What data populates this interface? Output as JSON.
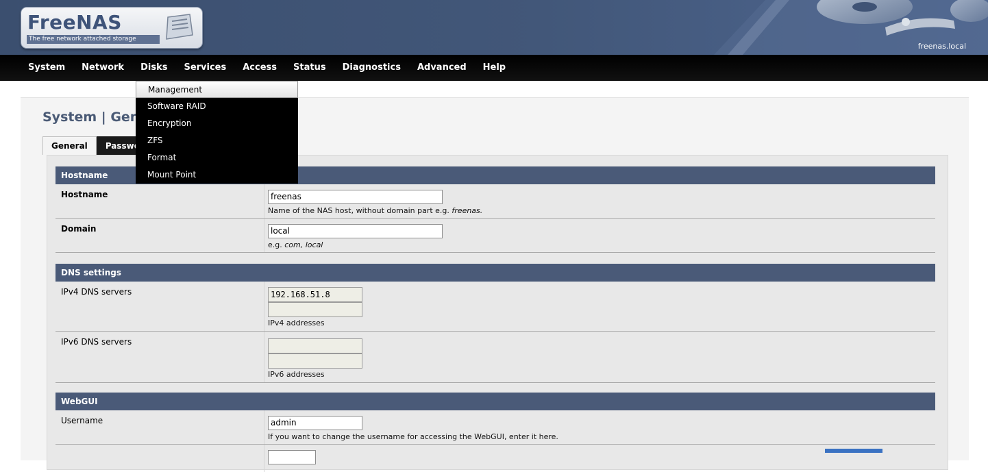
{
  "header": {
    "app_name": "FreeNAS",
    "tagline": "The free network attached storage",
    "hostname_display": "freenas.local"
  },
  "nav": {
    "items": [
      "System",
      "Network",
      "Disks",
      "Services",
      "Access",
      "Status",
      "Diagnostics",
      "Advanced",
      "Help"
    ]
  },
  "disks_menu": {
    "items": [
      "Management",
      "Software RAID",
      "Encryption",
      "ZFS",
      "Format",
      "Mount Point"
    ],
    "highlighted": "Management"
  },
  "page": {
    "title": "System | Gene",
    "tabs": [
      "General",
      "Passwo"
    ]
  },
  "sections": {
    "hostname": {
      "heading": "Hostname",
      "hostname_label": "Hostname",
      "hostname_value": "freenas",
      "hostname_hint_prefix": "Name of the NAS host, without domain part e.g. ",
      "hostname_hint_example": "freenas.",
      "domain_label": "Domain",
      "domain_value": "local",
      "domain_hint_prefix": "e.g. ",
      "domain_hint_example": "com, local"
    },
    "dns": {
      "heading": "DNS settings",
      "ipv4_label": "IPv4 DNS servers",
      "ipv4_value_1": "192.168.51.8",
      "ipv4_value_2": "",
      "ipv4_hint": "IPv4 addresses",
      "ipv6_label": "IPv6 DNS servers",
      "ipv6_value_1": "",
      "ipv6_value_2": "",
      "ipv6_hint": "IPv6 addresses"
    },
    "webgui": {
      "heading": "WebGUI",
      "username_label": "Username",
      "username_value": "admin",
      "username_hint": "If you want to change the username for accessing the WebGUI, enter it here."
    }
  },
  "colors": {
    "header_bg": "#425779",
    "section_head_bg": "#4a5a78",
    "nav_bg": "#000000"
  }
}
